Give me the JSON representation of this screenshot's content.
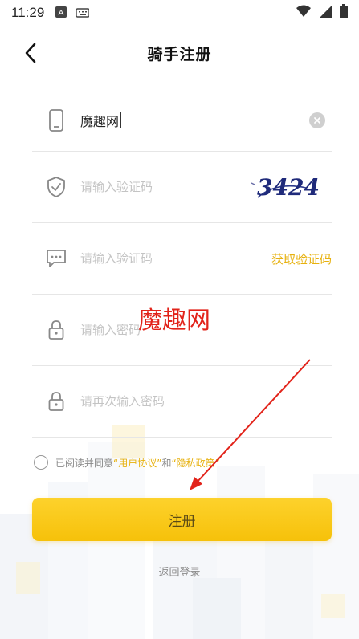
{
  "status_bar": {
    "time": "11:29"
  },
  "header": {
    "title": "骑手注册"
  },
  "form": {
    "name_value": "魔趣网",
    "captcha_placeholder": "请输入验证码",
    "captcha_text": "3424",
    "sms_placeholder": "请输入验证码",
    "get_code_label": "获取验证码",
    "password_placeholder": "请输入密码",
    "confirm_placeholder": "请再次输入密码"
  },
  "agreement": {
    "prefix": "已阅读并同意",
    "user_agreement": "“用户协议”",
    "and": "和",
    "privacy_policy": "“隐私政策”"
  },
  "submit_label": "注册",
  "back_login_label": "返回登录",
  "watermark": "魔趣网",
  "colors": {
    "accent": "#f6c10a",
    "link": "#e7b10e",
    "annotation": "#e2231a"
  }
}
